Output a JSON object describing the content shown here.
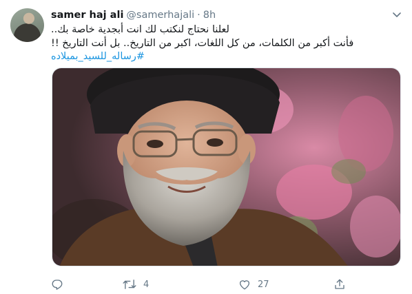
{
  "author": {
    "name": "samer haj ali",
    "handle": "@samerhajali",
    "separator": "·",
    "time": "8h"
  },
  "body": {
    "line1": "لعلنا نحتاج لنكتب لك انت أبجدية خاصة بك..",
    "line2": "فأنت أكبر من الكلمات، من كل اللغات، اكبر من التاريخ.. بل أنت التاريخ !!",
    "hashtag": "#رساله_للسيد_بميلاده"
  },
  "actions": {
    "reply_count": "",
    "retweet_count": "4",
    "like_count": "27"
  },
  "icons": {
    "caret": "chevron-down-icon",
    "reply": "reply-icon",
    "retweet": "retweet-icon",
    "like": "heart-icon",
    "share": "share-icon"
  },
  "colors": {
    "text": "#14171a",
    "muted": "#657786",
    "link": "#1b95e0"
  }
}
